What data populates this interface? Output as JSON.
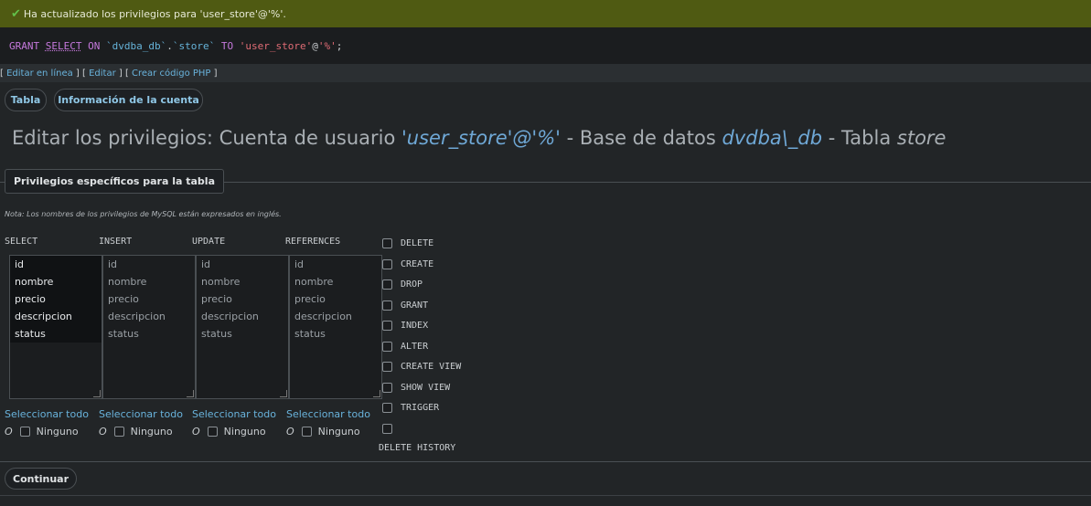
{
  "notification": {
    "message": "Ha actualizado los privilegios para 'user_store'@'%'."
  },
  "sql": {
    "tokens": [
      "GRANT",
      "SELECT",
      "ON",
      "`dvdba_db`",
      ".",
      "`store`",
      "TO",
      "'user_store'",
      "@",
      "'%'",
      ";"
    ]
  },
  "links": {
    "inline_edit": "Editar en línea",
    "edit": "Editar",
    "php": "Crear código PHP"
  },
  "tabs": {
    "table": "Tabla",
    "account": "Información de la cuenta"
  },
  "title": {
    "prefix": "Editar los privilegios: Cuenta de usuario ",
    "user": "'user_store'@'%'",
    "mid": " - Base de datos ",
    "db": "dvdba\\_db",
    "mid2": " - Tabla ",
    "table": "store"
  },
  "legend": "Privilegios específicos para la tabla",
  "note": "Nota: Los nombres de los privilegios de MySQL están expresados en inglés.",
  "columns": [
    {
      "header": "SELECT",
      "options": [
        "id",
        "nombre",
        "precio",
        "descripcion",
        "status"
      ]
    },
    {
      "header": "INSERT",
      "options": [
        "id",
        "nombre",
        "precio",
        "descripcion",
        "status"
      ]
    },
    {
      "header": "UPDATE",
      "options": [
        "id",
        "nombre",
        "precio",
        "descripcion",
        "status"
      ]
    },
    {
      "header": "REFERENCES",
      "options": [
        "id",
        "nombre",
        "precio",
        "descripcion",
        "status"
      ]
    }
  ],
  "select_all": "Seleccionar todo",
  "or_label": "O",
  "none_label": "Ninguno",
  "privileges": [
    "DELETE",
    "CREATE",
    "DROP",
    "GRANT",
    "INDEX",
    "ALTER",
    "CREATE VIEW",
    "SHOW VIEW",
    "TRIGGER",
    "DELETE HISTORY"
  ],
  "continue_button": "Continuar",
  "colors": {
    "success": "#4f5a12",
    "link": "#69b3dc",
    "accent_italic": "#6fa8d6"
  }
}
